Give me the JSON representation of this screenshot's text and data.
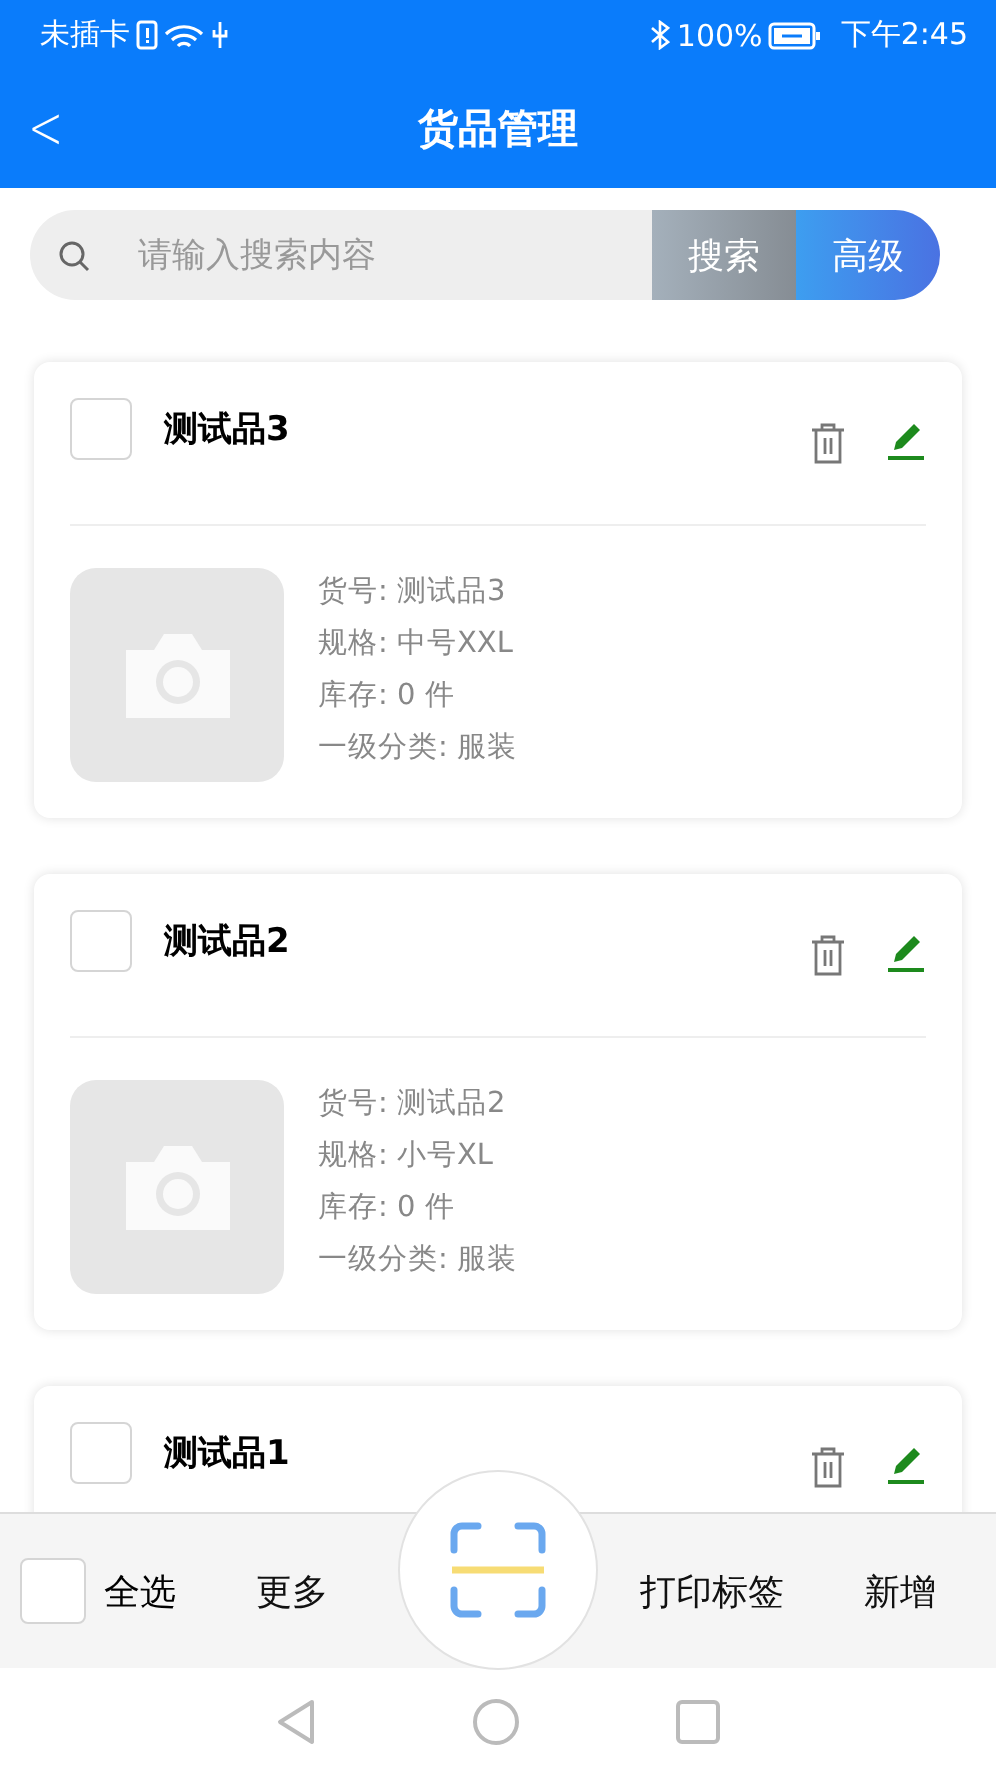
{
  "status_bar": {
    "carrier": "未插卡",
    "battery": "100%",
    "time": "下午2:45"
  },
  "header": {
    "back": "<",
    "title": "货品管理"
  },
  "search": {
    "placeholder": "请输入搜索内容",
    "search_button": "搜索",
    "advanced_button": "高级"
  },
  "items": [
    {
      "name": "测试品3",
      "checked": false,
      "details": [
        "货号: 测试品3",
        "规格: 中号XXL",
        "库存: 0 件",
        "一级分类: 服装"
      ]
    },
    {
      "name": "测试品2",
      "checked": false,
      "details": [
        "货号: 测试品2",
        "规格: 小号XL",
        "库存: 0 件",
        "一级分类: 服装"
      ]
    },
    {
      "name": "测试品1",
      "checked": false
    }
  ],
  "bottom_bar": {
    "select_all": {
      "label": "全选",
      "checked": false
    },
    "more": "更多",
    "print": "打印标签",
    "add": "新增"
  }
}
